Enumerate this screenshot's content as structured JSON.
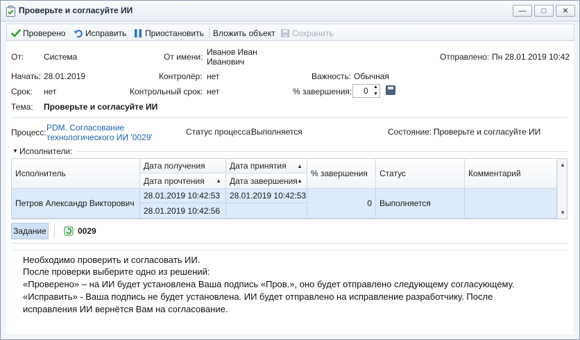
{
  "window": {
    "title": "Проверьте и согласуйте ИИ",
    "controls": {
      "minimize": "—",
      "maximize": "□",
      "close": "✕"
    }
  },
  "toolbar": {
    "checked": "Проверено",
    "fix": "Исправить",
    "suspend": "Приостановить",
    "attach": "Вложить объект",
    "save": "Сохранить"
  },
  "header": {
    "from_label": "От:",
    "from_value": "Система",
    "on_behalf_label": "От имени:",
    "on_behalf_line1": "Иванов Иван",
    "on_behalf_line2": "Иванович",
    "sent_label": "Отправлено:",
    "sent_value": "Пн 28.01.2019 10:42",
    "start_label": "Начать:",
    "start_value": "28.01.2019",
    "controller_label": "Контролёр:",
    "controller_value": "нет",
    "importance_label": "Важность:",
    "importance_value": "Обычная",
    "due_label": "Срок:",
    "due_value": "нет",
    "control_due_label": "Контрольный срок:",
    "control_due_value": "нет",
    "percent_label": "% завершения:",
    "percent_value": "0",
    "subject_label": "Тема:",
    "subject_value": "Проверьте и согласуйте ИИ"
  },
  "process": {
    "label": "Процесс:",
    "link_line1": "PDM. Согласование",
    "link_line2": "технологического ИИ '0029'",
    "status_label": "Статус процесса:",
    "status_value": "Выполняется",
    "state_label": "Состояние:",
    "state_value": "Проверьте и согласуйте ИИ"
  },
  "executors": {
    "section_label": "Исполнители:",
    "columns": {
      "executor": "Исполнитель",
      "received_date": "Дата получения",
      "read_date": "Дата прочтения",
      "accepted_date": "Дата принятия",
      "completed_date": "Дата завершения",
      "percent": "% завершения",
      "status": "Статус",
      "comment": "Комментарий"
    },
    "rows": [
      {
        "executor": "Петров Александр Викторович",
        "received_date": "28.01.2019 10:42:53",
        "read_date": "28.01.2019 10:42:56",
        "accepted_date": "28.01.2019 10:42:53",
        "completed_date": "",
        "percent": "0",
        "status": "Выполняется",
        "comment": ""
      }
    ]
  },
  "task": {
    "tab_label": "Задание",
    "number": "0029",
    "text_lines": [
      "Необходимо проверить и согласовать ИИ.",
      "После проверки выберите одно из решений:",
      "«Проверено» – на ИИ будет установлена Ваша подпись «Пров.», оно будет отправлено следующему согласующему.",
      "«Исправить» - Ваша подпись не будет установлена. ИИ будет отправлено на исправление разработчику. После",
      "исправления ИИ вернётся Вам на согласование."
    ]
  },
  "colors": {
    "accent": "#1f5fa8",
    "selected_row": "#ddeaf9",
    "tab_active": "#cfe0f5",
    "check_green": "#2e9e3a"
  }
}
